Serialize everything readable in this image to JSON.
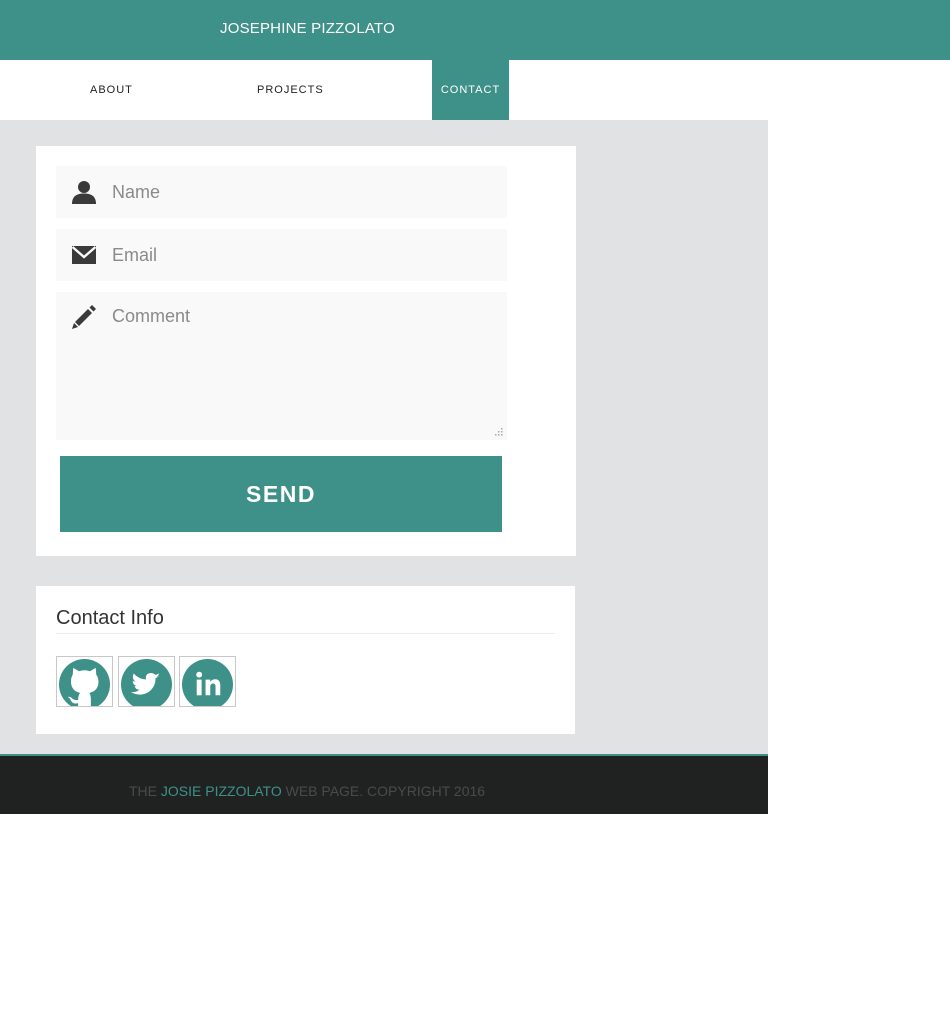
{
  "header": {
    "title": "JOSEPHINE PIZZOLATO"
  },
  "nav": {
    "items": [
      {
        "label": "ABOUT"
      },
      {
        "label": "PROJECTS"
      },
      {
        "label": "CONTACT",
        "active": true
      }
    ]
  },
  "form": {
    "name_placeholder": "Name",
    "email_placeholder": "Email",
    "comment_placeholder": "Comment",
    "send_label": "SEND"
  },
  "contact_info": {
    "title": "Contact Info",
    "links": [
      {
        "icon": "github-icon"
      },
      {
        "icon": "twitter-icon"
      },
      {
        "icon": "linkedin-icon"
      }
    ]
  },
  "footer": {
    "prefix": "THE ",
    "name": "JOSIE PIZZOLATO",
    "suffix": " WEB PAGE. COPYRIGHT 2016"
  },
  "colors": {
    "accent": "#3e9189",
    "background": "#e1e2e3",
    "footer": "#202222"
  }
}
